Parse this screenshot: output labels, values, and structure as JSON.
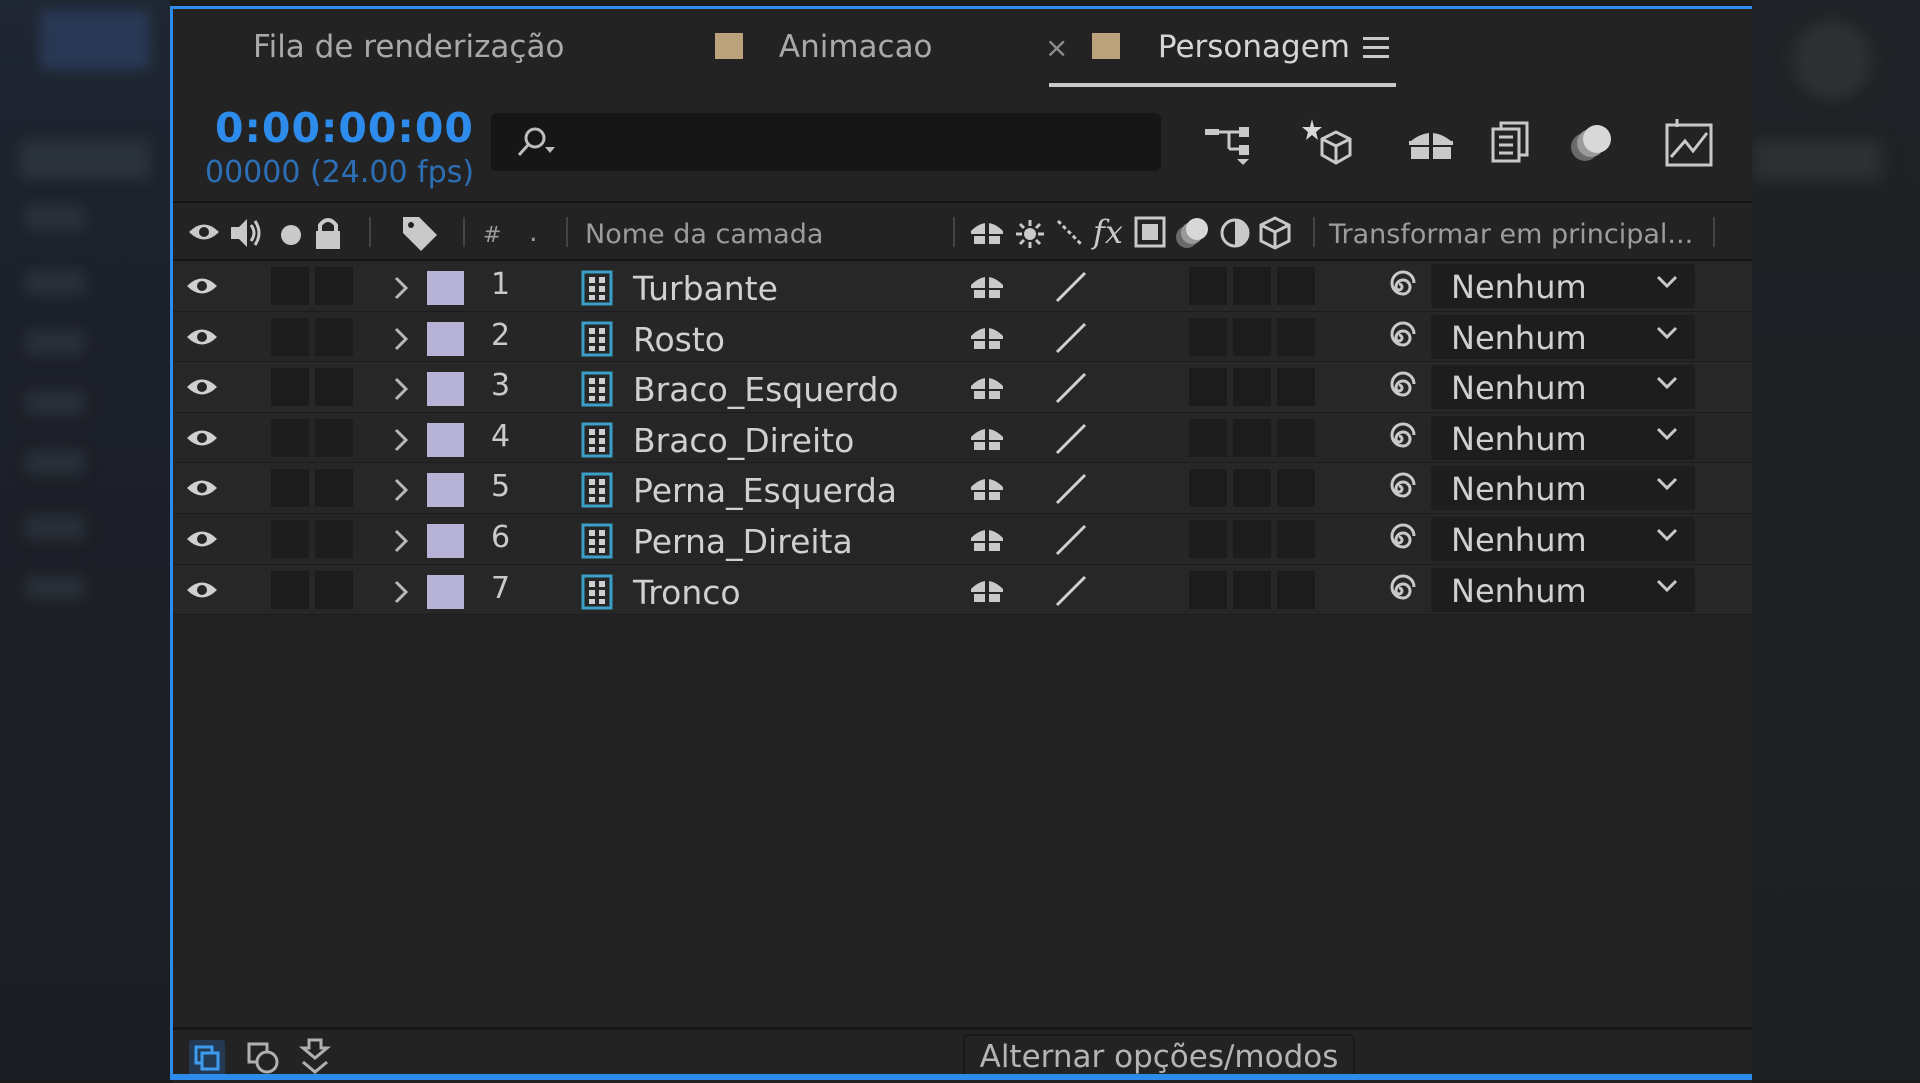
{
  "tabs": [
    {
      "label": "Fila de renderização",
      "active": false
    },
    {
      "label": "Animacao",
      "active": false
    },
    {
      "label": "Personagem",
      "active": true
    }
  ],
  "close_glyph": "×",
  "timecode": "0:00:00:00",
  "frame_info": "00000 (24.00 fps)",
  "search": {
    "value": "",
    "placeholder": ""
  },
  "columns": {
    "number": "#",
    "dot": ".",
    "layer_name": "Nome da camada",
    "parent": "Transformar em principal..."
  },
  "layers": [
    {
      "index": "1",
      "name": "Turbante",
      "parent": "Nenhum"
    },
    {
      "index": "2",
      "name": "Rosto",
      "parent": "Nenhum"
    },
    {
      "index": "3",
      "name": "Braco_Esquerdo",
      "parent": "Nenhum"
    },
    {
      "index": "4",
      "name": "Braco_Direito",
      "parent": "Nenhum"
    },
    {
      "index": "5",
      "name": "Perna_Esquerda",
      "parent": "Nenhum"
    },
    {
      "index": "6",
      "name": "Perna_Direita",
      "parent": "Nenhum"
    },
    {
      "index": "7",
      "name": "Tronco",
      "parent": "Nenhum"
    }
  ],
  "footer": {
    "toggle_label": "Alternar opções/modos"
  },
  "colors": {
    "accent": "#2d8ceb",
    "label": "#b6b3d6",
    "swatch": "#bba27d"
  }
}
